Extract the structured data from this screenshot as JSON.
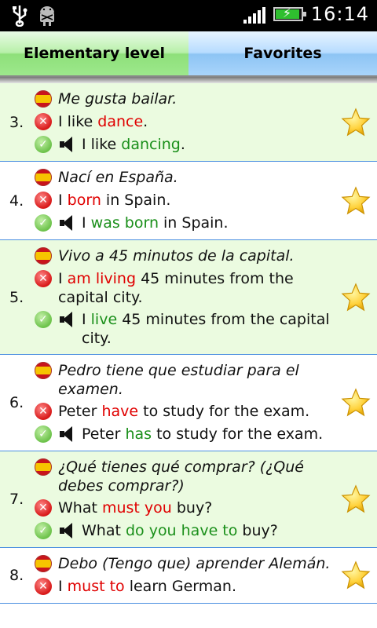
{
  "statusbar": {
    "time": "16:14"
  },
  "tabs": [
    {
      "label": "Elementary level",
      "selected": true
    },
    {
      "label": "Favorites",
      "selected": false
    }
  ],
  "items": [
    {
      "number": "3.",
      "spanish": "Me gusta bailar.",
      "wrong": [
        {
          "t": "I like ",
          "h": false
        },
        {
          "t": "dance",
          "h": true
        },
        {
          "t": ".",
          "h": false
        }
      ],
      "right": [
        {
          "t": "I like ",
          "h": false
        },
        {
          "t": "dancing",
          "h": true
        },
        {
          "t": ".",
          "h": false
        }
      ],
      "favorite": true
    },
    {
      "number": "4.",
      "spanish": "Nací en España.",
      "wrong": [
        {
          "t": "I ",
          "h": false
        },
        {
          "t": "born",
          "h": true
        },
        {
          "t": " in Spain.",
          "h": false
        }
      ],
      "right": [
        {
          "t": "I ",
          "h": false
        },
        {
          "t": "was born",
          "h": true
        },
        {
          "t": " in Spain.",
          "h": false
        }
      ],
      "favorite": true
    },
    {
      "number": "5.",
      "spanish": "Vivo a 45 minutos de la capital.",
      "wrong": [
        {
          "t": "I ",
          "h": false
        },
        {
          "t": "am living",
          "h": true
        },
        {
          "t": " 45 minutes from the capital city.",
          "h": false
        }
      ],
      "right": [
        {
          "t": "I ",
          "h": false
        },
        {
          "t": "live",
          "h": true
        },
        {
          "t": " 45 minutes from the capital city.",
          "h": false
        }
      ],
      "favorite": true
    },
    {
      "number": "6.",
      "spanish": "Pedro tiene que estudiar para el examen.",
      "wrong": [
        {
          "t": "Peter ",
          "h": false
        },
        {
          "t": "have",
          "h": true
        },
        {
          "t": " to study for the exam.",
          "h": false
        }
      ],
      "right": [
        {
          "t": "Peter ",
          "h": false
        },
        {
          "t": "has",
          "h": true
        },
        {
          "t": " to study for the exam.",
          "h": false
        }
      ],
      "favorite": true
    },
    {
      "number": "7.",
      "spanish": "¿Qué tienes qué comprar? (¿Qué debes comprar?)",
      "wrong": [
        {
          "t": "What ",
          "h": false
        },
        {
          "t": "must you",
          "h": true
        },
        {
          "t": " buy?",
          "h": false
        }
      ],
      "right": [
        {
          "t": "What ",
          "h": false
        },
        {
          "t": "do you have to",
          "h": true
        },
        {
          "t": " buy?",
          "h": false
        }
      ],
      "favorite": true
    },
    {
      "number": "8.",
      "spanish": "Debo (Tengo que) aprender Alemán.",
      "wrong": [
        {
          "t": "I ",
          "h": false
        },
        {
          "t": "must to",
          "h": true
        },
        {
          "t": " learn German.",
          "h": false
        }
      ],
      "right": [],
      "favorite": true
    }
  ],
  "colors": {
    "wrong": "#e00000",
    "right": "#1a8f1a",
    "row_alt": "#ebfbe0",
    "divider": "#4a8fe0"
  }
}
